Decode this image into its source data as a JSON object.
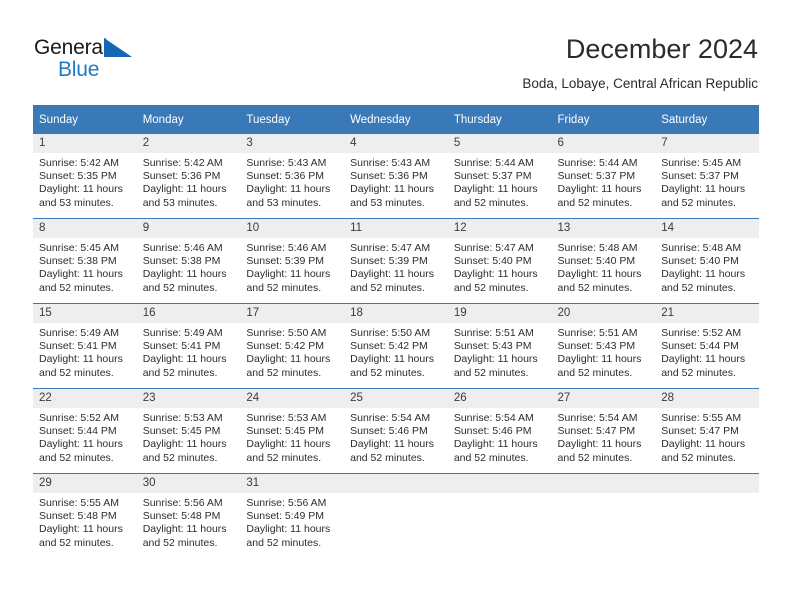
{
  "brand": {
    "name_top": "General",
    "name_bottom": "Blue",
    "accent_color": "#1f7bc4",
    "triangle_color": "#1567b5"
  },
  "header": {
    "title": "December 2024",
    "location": "Boda, Lobaye, Central African Republic"
  },
  "calendar": {
    "header_bg": "#3a79b8",
    "header_text_color": "#ffffff",
    "daynum_bg": "#eeeeee",
    "weekday_headers": [
      "Sunday",
      "Monday",
      "Tuesday",
      "Wednesday",
      "Thursday",
      "Friday",
      "Saturday"
    ],
    "weeks": [
      [
        {
          "day": "1",
          "sunrise": "Sunrise: 5:42 AM",
          "sunset": "Sunset: 5:35 PM",
          "daylight1": "Daylight: 11 hours",
          "daylight2": "and 53 minutes."
        },
        {
          "day": "2",
          "sunrise": "Sunrise: 5:42 AM",
          "sunset": "Sunset: 5:36 PM",
          "daylight1": "Daylight: 11 hours",
          "daylight2": "and 53 minutes."
        },
        {
          "day": "3",
          "sunrise": "Sunrise: 5:43 AM",
          "sunset": "Sunset: 5:36 PM",
          "daylight1": "Daylight: 11 hours",
          "daylight2": "and 53 minutes."
        },
        {
          "day": "4",
          "sunrise": "Sunrise: 5:43 AM",
          "sunset": "Sunset: 5:36 PM",
          "daylight1": "Daylight: 11 hours",
          "daylight2": "and 53 minutes."
        },
        {
          "day": "5",
          "sunrise": "Sunrise: 5:44 AM",
          "sunset": "Sunset: 5:37 PM",
          "daylight1": "Daylight: 11 hours",
          "daylight2": "and 52 minutes."
        },
        {
          "day": "6",
          "sunrise": "Sunrise: 5:44 AM",
          "sunset": "Sunset: 5:37 PM",
          "daylight1": "Daylight: 11 hours",
          "daylight2": "and 52 minutes."
        },
        {
          "day": "7",
          "sunrise": "Sunrise: 5:45 AM",
          "sunset": "Sunset: 5:37 PM",
          "daylight1": "Daylight: 11 hours",
          "daylight2": "and 52 minutes."
        }
      ],
      [
        {
          "day": "8",
          "sunrise": "Sunrise: 5:45 AM",
          "sunset": "Sunset: 5:38 PM",
          "daylight1": "Daylight: 11 hours",
          "daylight2": "and 52 minutes."
        },
        {
          "day": "9",
          "sunrise": "Sunrise: 5:46 AM",
          "sunset": "Sunset: 5:38 PM",
          "daylight1": "Daylight: 11 hours",
          "daylight2": "and 52 minutes."
        },
        {
          "day": "10",
          "sunrise": "Sunrise: 5:46 AM",
          "sunset": "Sunset: 5:39 PM",
          "daylight1": "Daylight: 11 hours",
          "daylight2": "and 52 minutes."
        },
        {
          "day": "11",
          "sunrise": "Sunrise: 5:47 AM",
          "sunset": "Sunset: 5:39 PM",
          "daylight1": "Daylight: 11 hours",
          "daylight2": "and 52 minutes."
        },
        {
          "day": "12",
          "sunrise": "Sunrise: 5:47 AM",
          "sunset": "Sunset: 5:40 PM",
          "daylight1": "Daylight: 11 hours",
          "daylight2": "and 52 minutes."
        },
        {
          "day": "13",
          "sunrise": "Sunrise: 5:48 AM",
          "sunset": "Sunset: 5:40 PM",
          "daylight1": "Daylight: 11 hours",
          "daylight2": "and 52 minutes."
        },
        {
          "day": "14",
          "sunrise": "Sunrise: 5:48 AM",
          "sunset": "Sunset: 5:40 PM",
          "daylight1": "Daylight: 11 hours",
          "daylight2": "and 52 minutes."
        }
      ],
      [
        {
          "day": "15",
          "sunrise": "Sunrise: 5:49 AM",
          "sunset": "Sunset: 5:41 PM",
          "daylight1": "Daylight: 11 hours",
          "daylight2": "and 52 minutes."
        },
        {
          "day": "16",
          "sunrise": "Sunrise: 5:49 AM",
          "sunset": "Sunset: 5:41 PM",
          "daylight1": "Daylight: 11 hours",
          "daylight2": "and 52 minutes."
        },
        {
          "day": "17",
          "sunrise": "Sunrise: 5:50 AM",
          "sunset": "Sunset: 5:42 PM",
          "daylight1": "Daylight: 11 hours",
          "daylight2": "and 52 minutes."
        },
        {
          "day": "18",
          "sunrise": "Sunrise: 5:50 AM",
          "sunset": "Sunset: 5:42 PM",
          "daylight1": "Daylight: 11 hours",
          "daylight2": "and 52 minutes."
        },
        {
          "day": "19",
          "sunrise": "Sunrise: 5:51 AM",
          "sunset": "Sunset: 5:43 PM",
          "daylight1": "Daylight: 11 hours",
          "daylight2": "and 52 minutes."
        },
        {
          "day": "20",
          "sunrise": "Sunrise: 5:51 AM",
          "sunset": "Sunset: 5:43 PM",
          "daylight1": "Daylight: 11 hours",
          "daylight2": "and 52 minutes."
        },
        {
          "day": "21",
          "sunrise": "Sunrise: 5:52 AM",
          "sunset": "Sunset: 5:44 PM",
          "daylight1": "Daylight: 11 hours",
          "daylight2": "and 52 minutes."
        }
      ],
      [
        {
          "day": "22",
          "sunrise": "Sunrise: 5:52 AM",
          "sunset": "Sunset: 5:44 PM",
          "daylight1": "Daylight: 11 hours",
          "daylight2": "and 52 minutes."
        },
        {
          "day": "23",
          "sunrise": "Sunrise: 5:53 AM",
          "sunset": "Sunset: 5:45 PM",
          "daylight1": "Daylight: 11 hours",
          "daylight2": "and 52 minutes."
        },
        {
          "day": "24",
          "sunrise": "Sunrise: 5:53 AM",
          "sunset": "Sunset: 5:45 PM",
          "daylight1": "Daylight: 11 hours",
          "daylight2": "and 52 minutes."
        },
        {
          "day": "25",
          "sunrise": "Sunrise: 5:54 AM",
          "sunset": "Sunset: 5:46 PM",
          "daylight1": "Daylight: 11 hours",
          "daylight2": "and 52 minutes."
        },
        {
          "day": "26",
          "sunrise": "Sunrise: 5:54 AM",
          "sunset": "Sunset: 5:46 PM",
          "daylight1": "Daylight: 11 hours",
          "daylight2": "and 52 minutes."
        },
        {
          "day": "27",
          "sunrise": "Sunrise: 5:54 AM",
          "sunset": "Sunset: 5:47 PM",
          "daylight1": "Daylight: 11 hours",
          "daylight2": "and 52 minutes."
        },
        {
          "day": "28",
          "sunrise": "Sunrise: 5:55 AM",
          "sunset": "Sunset: 5:47 PM",
          "daylight1": "Daylight: 11 hours",
          "daylight2": "and 52 minutes."
        }
      ],
      [
        {
          "day": "29",
          "sunrise": "Sunrise: 5:55 AM",
          "sunset": "Sunset: 5:48 PM",
          "daylight1": "Daylight: 11 hours",
          "daylight2": "and 52 minutes."
        },
        {
          "day": "30",
          "sunrise": "Sunrise: 5:56 AM",
          "sunset": "Sunset: 5:48 PM",
          "daylight1": "Daylight: 11 hours",
          "daylight2": "and 52 minutes."
        },
        {
          "day": "31",
          "sunrise": "Sunrise: 5:56 AM",
          "sunset": "Sunset: 5:49 PM",
          "daylight1": "Daylight: 11 hours",
          "daylight2": "and 52 minutes."
        },
        {
          "day": "",
          "sunrise": "",
          "sunset": "",
          "daylight1": "",
          "daylight2": ""
        },
        {
          "day": "",
          "sunrise": "",
          "sunset": "",
          "daylight1": "",
          "daylight2": ""
        },
        {
          "day": "",
          "sunrise": "",
          "sunset": "",
          "daylight1": "",
          "daylight2": ""
        },
        {
          "day": "",
          "sunrise": "",
          "sunset": "",
          "daylight1": "",
          "daylight2": ""
        }
      ]
    ]
  }
}
